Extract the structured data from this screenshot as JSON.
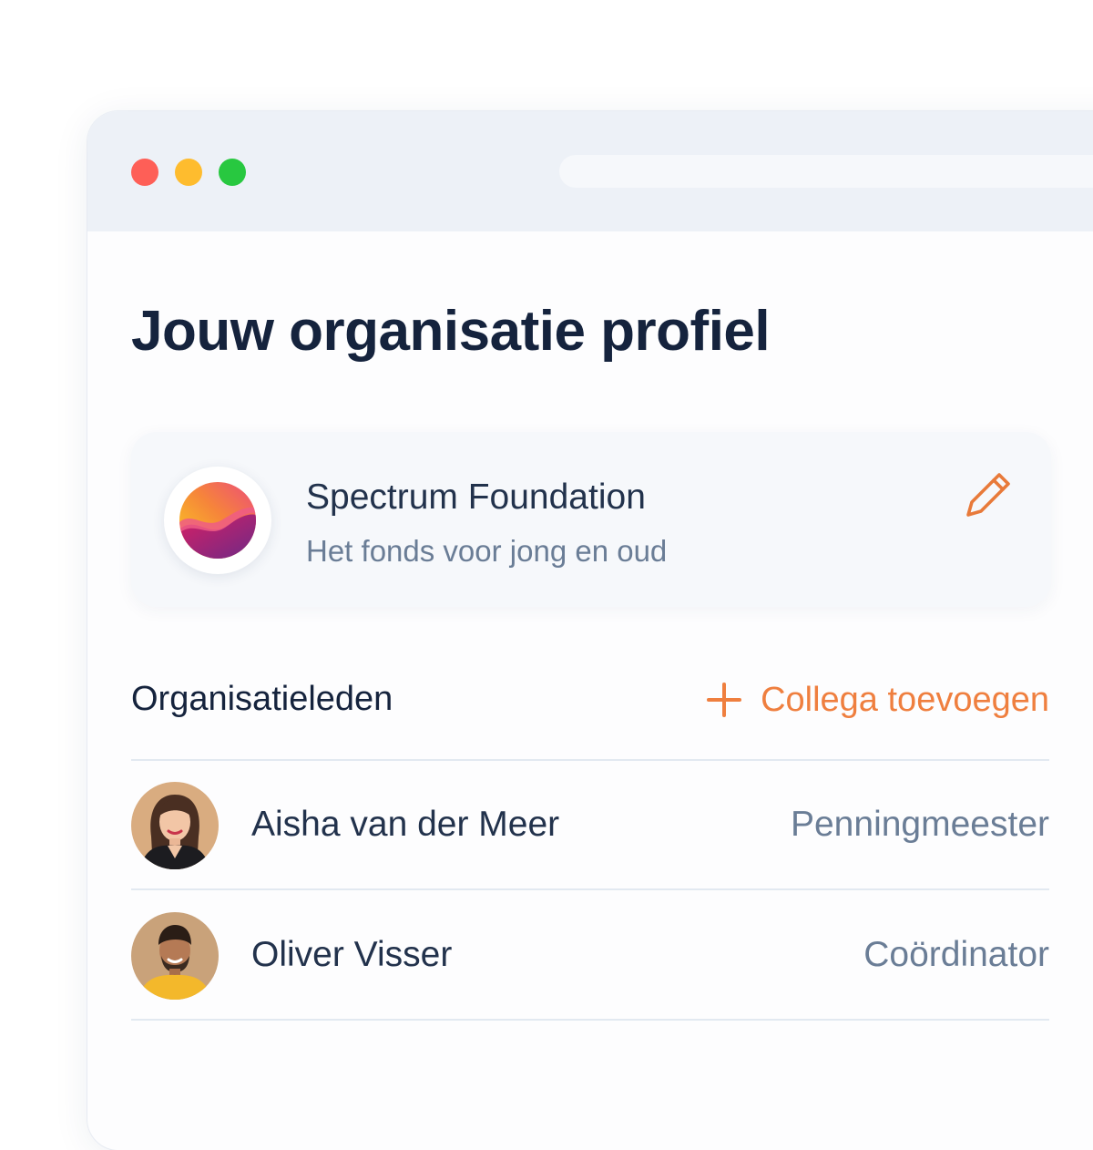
{
  "page": {
    "title": "Jouw organisatie profiel"
  },
  "organization": {
    "name": "Spectrum Foundation",
    "tagline": "Het fonds voor jong en oud",
    "logo_icon": "spectrum-logo-icon",
    "edit_icon": "pencil-icon"
  },
  "members": {
    "heading": "Organisatieleden",
    "add_label": "Collega toevoegen",
    "add_icon": "plus-icon",
    "list": [
      {
        "name": "Aisha van der Meer",
        "role": "Penningmeester",
        "avatar_icon": "avatar-photo"
      },
      {
        "name": "Oliver Visser",
        "role": "Coördinator",
        "avatar_icon": "avatar-photo"
      }
    ]
  },
  "colors": {
    "accent": "#ef7f3f",
    "title": "#15233d",
    "muted": "#6a7d96",
    "titlebar": "#edf1f7",
    "traffic_red": "#fe5f57",
    "traffic_yellow": "#febc2e",
    "traffic_green": "#28c840"
  }
}
